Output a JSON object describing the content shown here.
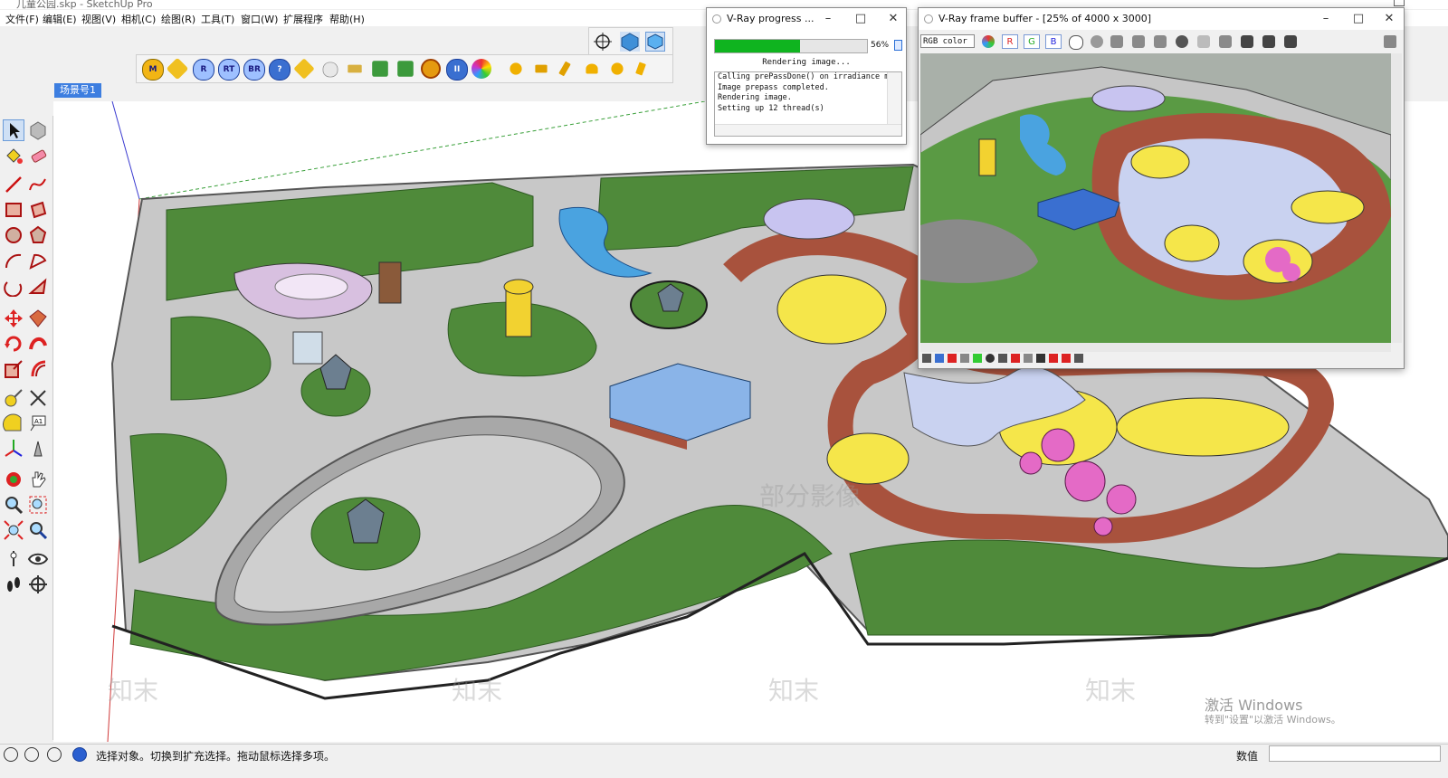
{
  "window": {
    "title": "儿童公园.skp - SketchUp Pro"
  },
  "menu": {
    "items": [
      "文件(F)",
      "编辑(E)",
      "视图(V)",
      "相机(C)",
      "绘图(R)",
      "工具(T)",
      "窗口(W)",
      "扩展程序",
      "帮助(H)"
    ]
  },
  "toolbar_top": {
    "icons": [
      "orbit-crosshair-icon",
      "vray-light-icon",
      "vray-material-icon"
    ]
  },
  "toolbar_plugins": {
    "labels": [
      "M",
      "",
      "R",
      "RT",
      "BR",
      "?",
      "",
      "",
      "",
      "",
      "",
      "",
      "",
      ""
    ]
  },
  "scene": {
    "tab_label": "场景号1"
  },
  "left_tools": [
    "select",
    "make-component",
    "paint-bucket",
    "eraser",
    "line",
    "freehand",
    "rectangle",
    "rotated-rectangle",
    "circle",
    "polygon",
    "arc",
    "pie",
    "three-point-arc",
    "two-point-arc",
    "move",
    "push-pull",
    "rotate",
    "follow-me",
    "scale",
    "offset",
    "tape-measure",
    "dimension",
    "protractor",
    "text",
    "axes",
    "3d-text",
    "orbit",
    "pan",
    "zoom",
    "zoom-window",
    "zoom-extents",
    "previous-view",
    "position-camera",
    "look-around",
    "walk",
    "section-plane"
  ],
  "status": {
    "text": "选择对象。切换到扩充选择。拖动鼠标选择多项。",
    "vcb_label": "数值"
  },
  "viewport": {
    "watermark": "知末",
    "overlay_text": "部分影像",
    "activation_title": "激活 Windows",
    "activation_sub": "转到\"设置\"以激活 Windows。"
  },
  "vray_progress": {
    "title": "V-Ray progress ...",
    "status": "Rendering image...",
    "percent_label": "56%",
    "progress": 0.56,
    "log": [
      "Calling prePassDone() on irradiance map",
      "Image prepass completed.",
      "Rendering image.",
      "Setting up 12 thread(s)"
    ]
  },
  "vray_vfb": {
    "title": "V-Ray frame buffer - [25% of 4000 x 3000]",
    "channel": "RGB color",
    "rgb_buttons": [
      "R",
      "G",
      "B"
    ]
  },
  "colors": {
    "grass": "#4f8a3a",
    "paving": "#c8c8c8",
    "track": "#a8523d",
    "yellow": "#f5e64a",
    "pink": "#e46ac6",
    "water": "#4aa3e0",
    "lilac": "#c8c4f0",
    "progress_green": "#0fb41f",
    "scene_tab": "#3d7ee0"
  }
}
